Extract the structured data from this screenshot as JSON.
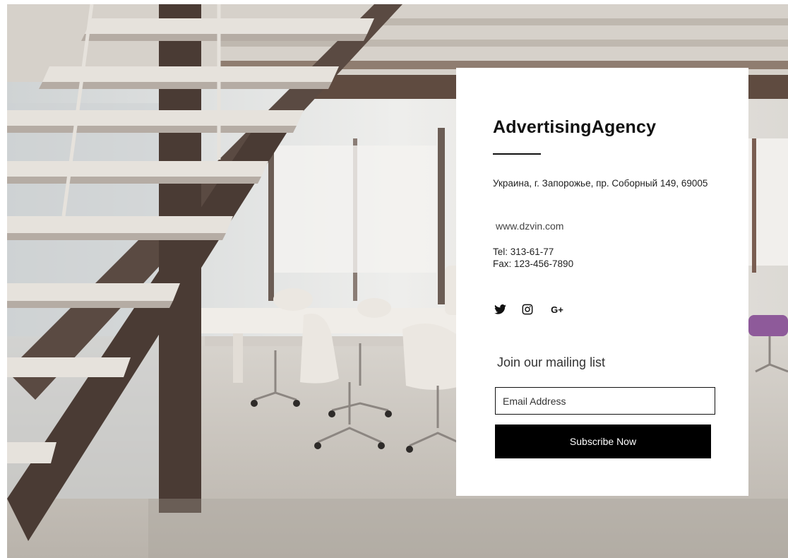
{
  "background": {
    "photo_icon": "office-interior-photo",
    "colors": {
      "floor": "#c9c4bd",
      "wall": "#e8e6e2",
      "ceiling": "#d9d5cf",
      "stair": "#5a4a42",
      "stair_highlight": "#e6e2dc",
      "chair": "#e9e5df",
      "accent_chair": "#8e5a9a"
    }
  },
  "card": {
    "brand": "AdvertisingAgency",
    "address": "Украина, г. Запорожье, пр. Соборный 149, 69005",
    "website": "www.dzvin.com",
    "phone": "Tel: 313-61-77",
    "fax": "Fax: 123-456-7890",
    "socials": [
      {
        "name": "twitter-icon"
      },
      {
        "name": "instagram-icon"
      },
      {
        "name": "google-plus-icon",
        "label": "G+"
      }
    ],
    "mailing": {
      "heading": "Join our mailing list",
      "email_placeholder": "Email Address",
      "button_label": "Subscribe Now"
    },
    "colors": {
      "card_bg": "#ffffff",
      "text": "#111111",
      "button_bg": "#000000",
      "button_text": "#ffffff"
    }
  }
}
